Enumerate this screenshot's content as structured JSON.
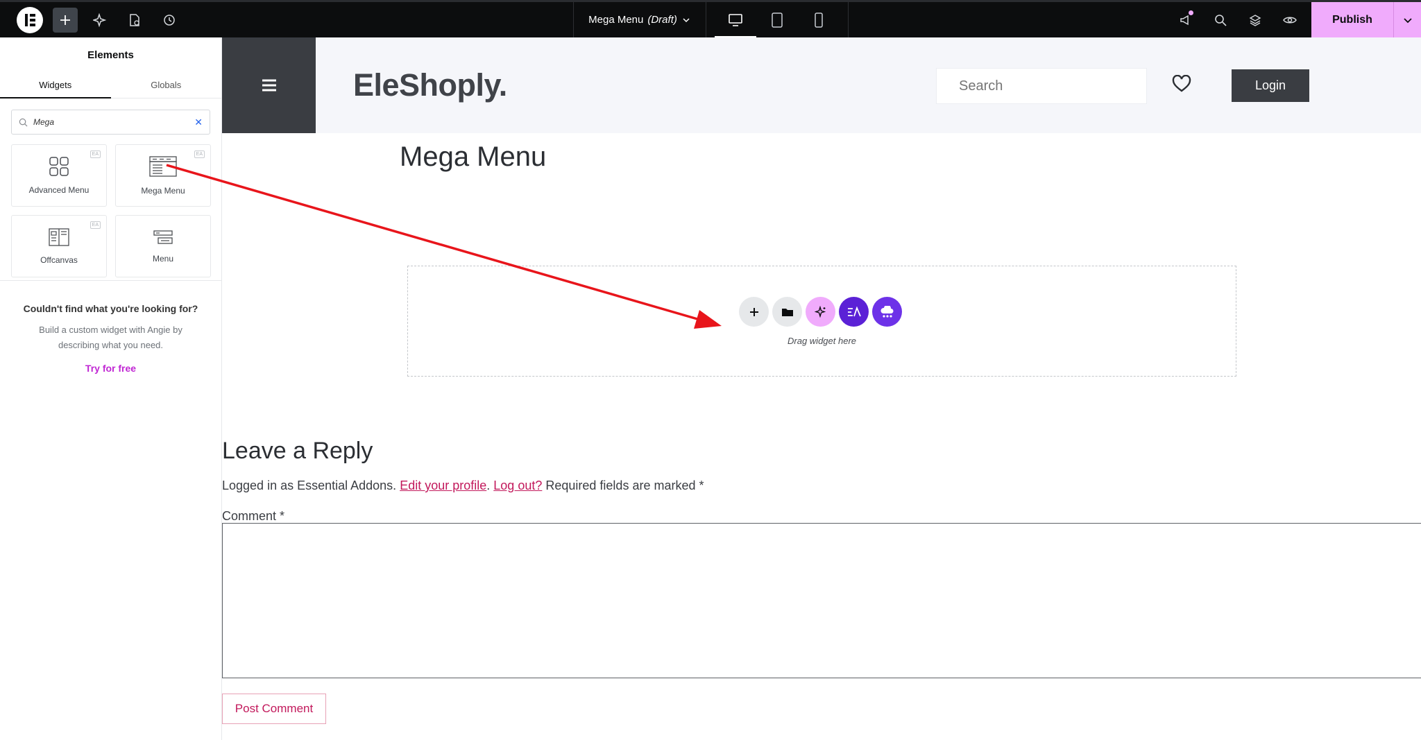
{
  "topbar": {
    "doc_title": "Mega Menu",
    "doc_status": "(Draft)",
    "publish_label": "Publish",
    "accent": "#f0abfc"
  },
  "panel": {
    "title": "Elements",
    "tabs": [
      {
        "label": "Widgets"
      },
      {
        "label": "Globals"
      }
    ],
    "search_value": "Mega",
    "widgets": [
      {
        "label": "Advanced Menu",
        "badge": "EA"
      },
      {
        "label": "Mega Menu",
        "badge": "EA"
      },
      {
        "label": "Offcanvas",
        "badge": "EA"
      },
      {
        "label": "Menu"
      }
    ],
    "promo": {
      "title": "Couldn't find what you're looking for?",
      "desc": "Build a custom widget with Angie by describing what you need.",
      "link": "Try for free"
    }
  },
  "site": {
    "brand": "EleShoply.",
    "search_placeholder": "Search",
    "login_label": "Login"
  },
  "page": {
    "title": "Mega Menu",
    "drop_text": "Drag widget here",
    "reply": {
      "title": "Leave a Reply",
      "logged_prefix": "Logged in as Essential Addons.",
      "edit_profile": "Edit your profile",
      "logout": "Log out?",
      "required": "Required fields are marked *",
      "comment_label": "Comment *",
      "post_button": "Post Comment"
    }
  }
}
